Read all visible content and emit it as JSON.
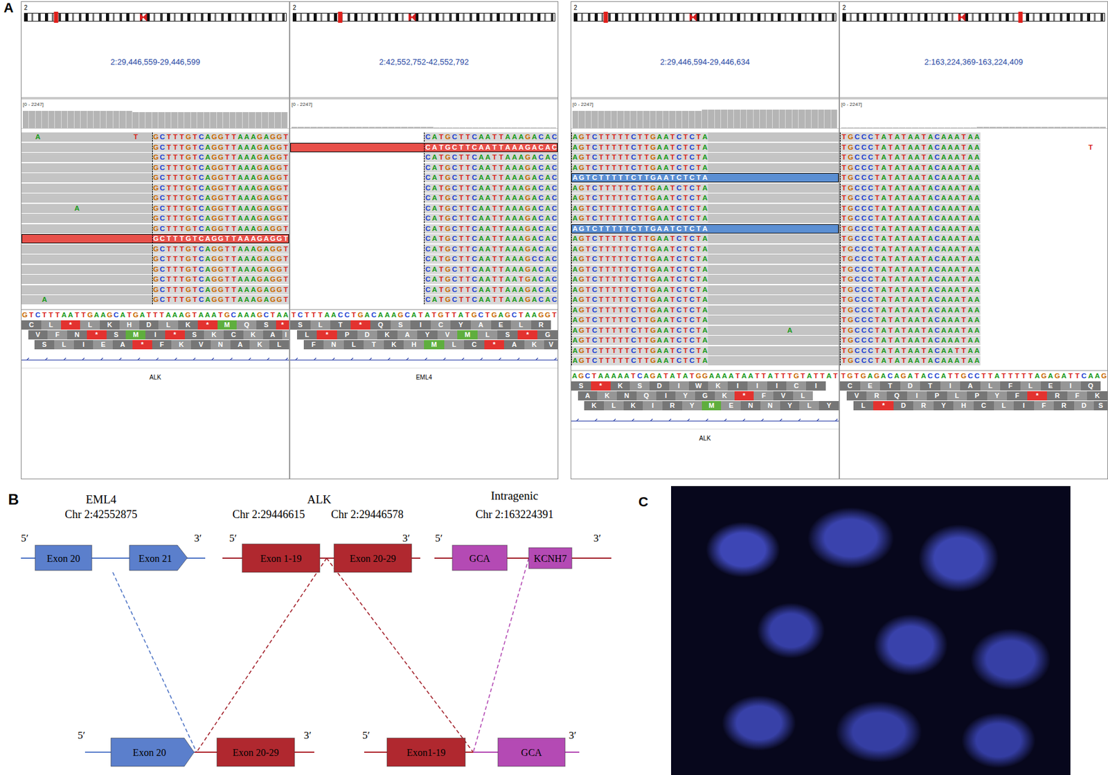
{
  "panel_a": {
    "label": "A",
    "groups": [
      {
        "panels": [
          {
            "chrom": "2",
            "locus": "2:29,446,559-29,446,599",
            "marker": 0.12,
            "range": "[0 - 2247]",
            "coverage": [
              0.86,
              0.86,
              0.86,
              0.86,
              0.86,
              0.86,
              0.86,
              0.86,
              0.86,
              0.86,
              0.86,
              0.86,
              0.86,
              0.86,
              0.86,
              0.86,
              0.86,
              0.78,
              0.78,
              0.78,
              0.78,
              0.78,
              0.78,
              0.78,
              0.78,
              0.78,
              0.78,
              0.78,
              0.78,
              0.78,
              0.78,
              0.78,
              0.78,
              0.78,
              0.78,
              0.78,
              0.78,
              0.78,
              0.78,
              0.78,
              0.78
            ],
            "aligned": [
              0,
              19
            ],
            "clip_start": 20,
            "highlight_color": "#e8504a",
            "reads": [
              {
                "bases": "GCTTTGTCAGGTTAAAGAGGT",
                "highlight": false,
                "snps": [
                  {
                    "col": 2,
                    "base": "A"
                  },
                  {
                    "col": 17,
                    "base": "T"
                  }
                ]
              },
              {
                "bases": "GCTTTGTCAGGTTAAAGAGGT",
                "highlight": false
              },
              {
                "bases": "GCTTTGTCAGGTTAAAGAGGT",
                "highlight": false
              },
              {
                "bases": "GCTTTGTCAGGTTAAAGAGGT",
                "highlight": false
              },
              {
                "bases": "GCTTTGTCAGGTTAAAGAGGT",
                "highlight": false
              },
              {
                "bases": "GCTTTGTCAGGTTAAAGAGGT",
                "highlight": false
              },
              {
                "bases": "GCTTTGTCAGGTTAAAGAGGT",
                "highlight": false
              },
              {
                "bases": "GCTTTGTCAGGTTAAAGAGGT",
                "highlight": false,
                "snps": [
                  {
                    "col": 8,
                    "base": "A"
                  }
                ]
              },
              {
                "bases": "GCTTTGTCAGGTTAAAGAGGT",
                "highlight": false
              },
              {
                "bases": "GCTTTGTCAGGTTAAAGAGGT",
                "highlight": false
              },
              {
                "bases": "GCTTTGTCAGGTTAAAGAGGT",
                "highlight": true
              },
              {
                "bases": "GCTTTGTCAGGTTAAAGAGGT",
                "highlight": false
              },
              {
                "bases": "GCTTTGTCAGGTTAAAGAGGT",
                "highlight": false
              },
              {
                "bases": "GCTTTGTCAGGTTAAAGAGGT",
                "highlight": false
              },
              {
                "bases": "GCTTTGTCAGGTTAAAGAGGT",
                "highlight": false
              },
              {
                "bases": "GCTTTGTCAGGTTAAAGAGGT",
                "highlight": false
              },
              {
                "bases": "GCTTTGTCAGGTTAAAGAGGT",
                "highlight": false,
                "snps": [
                  {
                    "col": 3,
                    "base": "A"
                  }
                ]
              }
            ],
            "reference": "GTCTTTAATTGAAGCATGATTTAAAGTAAATGCAAAGCTAA",
            "frames": [
              "CL*LKHDLK*MQS*",
              "VFN*SMI*SKCKAI",
              "SLIEA*FKVNAKL"
            ],
            "gene": "ALK"
          },
          {
            "chrom": "2",
            "locus": "2:42,552,752-42,552,792",
            "marker": 0.18,
            "range": "[0 - 2247]",
            "coverage": [
              0.05,
              0.05,
              0.05,
              0.05,
              0.05,
              0.05,
              0.05,
              0.05,
              0.05,
              0.05,
              0.05,
              0.05,
              0.05,
              0.05,
              0.05,
              0.05,
              0.05,
              0.05,
              0.05,
              0.05,
              0.05,
              0.05,
              0.03,
              0.03,
              0.03,
              0.03,
              0.03,
              0.03,
              0.03,
              0.03,
              0.03,
              0.03,
              0.03,
              0.03,
              0.03,
              0.03,
              0.03,
              0.03,
              0.03,
              0.03,
              0.03
            ],
            "clip_start": 20,
            "highlight_color": "#e8504a",
            "reads": [
              {
                "bases": "CATGCTTCAATTAAAGACAC",
                "highlight": false
              },
              {
                "bases": "CATGCTTCAATTAAAGACAC",
                "highlight": true
              },
              {
                "bases": "CATGCTTCAATTAAAGACAC",
                "highlight": false
              },
              {
                "bases": "CATGCTTCAATTAAAGACAC",
                "highlight": false
              },
              {
                "bases": "CATGCTTCAATTAAAGACAC",
                "highlight": false
              },
              {
                "bases": "CATGCTTCAATTAAAGACAC",
                "highlight": false
              },
              {
                "bases": "CATGCTTCAATTAAAGACAC",
                "highlight": false
              },
              {
                "bases": "CATGCTTCAATTAAAGACAC",
                "highlight": false
              },
              {
                "bases": "CATGCTTCAATTAAAGACAC",
                "highlight": false
              },
              {
                "bases": "CATGCTTCAATTAAAGACAC",
                "highlight": false
              },
              {
                "bases": "CATGCTTCAATTAAAGACAC",
                "highlight": false
              },
              {
                "bases": "CATGCTTCAATTAAAGACAC",
                "highlight": false
              },
              {
                "bases": "CATGCTTCAATTAAAGCCAC",
                "highlight": false
              },
              {
                "bases": "CATGCTTCAATTAAAGACAC",
                "highlight": false
              },
              {
                "bases": "CATGCTTCAATTAATGACAC",
                "highlight": false
              },
              {
                "bases": "CATGCTTCAATTAAAGACAC",
                "highlight": false
              },
              {
                "bases": "CATGCTTCAATTAAAGACAC",
                "highlight": false
              }
            ],
            "reference": "TCTTTAACCTGACAAAGCATATGTTATGCTGAGCTAAGGT",
            "frames": [
              "SLT*QSICYAELR",
              "L*PDKAYVMLS*G",
              "FNLTKHMLC*AKV"
            ],
            "gene": "EML4"
          }
        ]
      },
      {
        "panels": [
          {
            "chrom": "2",
            "locus": "2:29,446,594-29,446,634",
            "marker": 0.12,
            "range": "[0 - 2247]",
            "coverage": [
              0.84,
              0.84,
              0.84,
              0.84,
              0.84,
              0.84,
              0.84,
              0.84,
              0.84,
              0.84,
              0.84,
              0.84,
              0.84,
              0.84,
              0.84,
              0.84,
              0.84,
              0.84,
              0.84,
              0.84,
              0.9,
              0.9,
              0.9,
              0.9,
              0.9,
              0.9,
              0.9,
              0.9,
              0.9,
              0.9,
              0.9,
              0.9,
              0.9,
              0.9,
              0.9,
              0.9,
              0.9,
              0.9,
              0.9,
              0.9,
              0.9
            ],
            "aligned": [
              21,
              40
            ],
            "clip_start": 0,
            "highlight_color": "#5b8fd3",
            "reads": [
              {
                "bases": "AGTCTTTTTCTTGAATCTCTA",
                "highlight": false
              },
              {
                "bases": "AGTCTTTTTCTTGAATCTCTA",
                "highlight": false
              },
              {
                "bases": "AGTCTTTTTCTTGAATCTCTA",
                "highlight": false
              },
              {
                "bases": "AGTCTTTTTCTTGAATCTCTA",
                "highlight": false
              },
              {
                "bases": "AGTCTTTTTCTTGAATCTCTA",
                "highlight": true
              },
              {
                "bases": "AGTCTTTTTCTTGAATCTCTA",
                "highlight": false
              },
              {
                "bases": "AGTCTTTTTCTTGAATCTCTA",
                "highlight": false
              },
              {
                "bases": "AGTCTTTTTCTTGAATCTCTA",
                "highlight": false
              },
              {
                "bases": "AGTCTTTTTCTTGAATCTCTA",
                "highlight": false
              },
              {
                "bases": "AGTCTTTTTCTTGAATCTCTA",
                "highlight": true
              },
              {
                "bases": "AGTCTTTTTCTTGAATCTCTA",
                "highlight": false
              },
              {
                "bases": "AGTCTTTTTCTTGAATCTCTA",
                "highlight": false
              },
              {
                "bases": "AGTCTTTTTCTTGAATCTCTA",
                "highlight": false
              },
              {
                "bases": "AGTCTTTTTCTTGAATCTCTA",
                "highlight": false
              },
              {
                "bases": "AGTCTTTTTCTTGAATCTCTA",
                "highlight": false
              },
              {
                "bases": "AGTCTTTTTCTTGAATCTCTA",
                "highlight": false
              },
              {
                "bases": "AGTCTTTTTCTTGAATCTCTA",
                "highlight": false
              },
              {
                "bases": "AGTCTTTTTCTTGAATCTCTA",
                "highlight": false
              },
              {
                "bases": "AGTCTTTTTCTTGAATCTCTA",
                "highlight": false
              },
              {
                "bases": "AGTCTTTTTCTTGAATCTCTA",
                "highlight": false,
                "snps": [
                  {
                    "col": 33,
                    "base": "A"
                  }
                ]
              },
              {
                "bases": "AGTCTTTTTCTTGAATCTCTA",
                "highlight": false
              },
              {
                "bases": "AGTCTTTTTCTTGAATCTCTA",
                "highlight": false
              },
              {
                "bases": "AGTCTTTTTCTTGAATCTCTA",
                "highlight": false
              }
            ],
            "reference": "AGCTAAAAATCAGATATATGGAAAATAATTATTTGTATTAT",
            "frames": [
              "S*KSDIWKIIICI",
              "AKNQIYGK*FVL",
              "KLKIRYMENNYLY"
            ],
            "gene": "ALK"
          },
          {
            "chrom": "2",
            "locus": "2:163,224,369-163,224,409",
            "marker": 0.68,
            "range": "[0 - 2247]",
            "coverage": [
              0.03,
              0.03,
              0.03,
              0.03,
              0.03,
              0.03,
              0.03,
              0.03,
              0.03,
              0.03,
              0.03,
              0.03,
              0.03,
              0.03,
              0.03,
              0.03,
              0.03,
              0.03,
              0.03,
              0.03,
              0.03,
              0.06,
              0.06,
              0.06,
              0.06,
              0.06,
              0.06,
              0.06,
              0.06,
              0.06,
              0.06,
              0.06,
              0.06,
              0.06,
              0.06,
              0.06,
              0.06,
              0.06,
              0.06,
              0.06,
              0.06
            ],
            "clip_start": 0,
            "reads": [
              {
                "bases": "TGCCCTATATAATACAAATAA",
                "highlight": false
              },
              {
                "bases": "TGCCCTATATAATACAAATAA",
                "highlight": false,
                "snps": [
                  {
                    "col": 37,
                    "base": "T"
                  }
                ]
              },
              {
                "bases": "TGCCCTATATAATACAAATAA",
                "highlight": false
              },
              {
                "bases": "TGCCCTATATAATACAAATAA",
                "highlight": false
              },
              {
                "bases": "TGCCCTATATAATACAAATAA",
                "highlight": false
              },
              {
                "bases": "TGCCCTATATAATACAAATAA",
                "highlight": false
              },
              {
                "bases": "TGCCCTATATAATACAAATAA",
                "highlight": false
              },
              {
                "bases": "TGCCCTATATAATACAAATAA",
                "highlight": false
              },
              {
                "bases": "TGCCCTATATAATACAAATAA",
                "highlight": false
              },
              {
                "bases": "TGCCCTATATAATACAAATAA",
                "highlight": false
              },
              {
                "bases": "TGCCCTATATAATACAAATAA",
                "highlight": false
              },
              {
                "bases": "TGCCCTATATAATACAAATAA",
                "highlight": false
              },
              {
                "bases": "TGCCCTATATAATACAAATAA",
                "highlight": false
              },
              {
                "bases": "TGCCCTATATAATACAAATAA",
                "highlight": false
              },
              {
                "bases": "TGCCCTATATAATACAAATAA",
                "highlight": false
              },
              {
                "bases": "TGCCCTATATAATACAAATAA",
                "highlight": false
              },
              {
                "bases": "TGCCCTATATAATACAAATAA",
                "highlight": false
              },
              {
                "bases": "TGCCCTATATAATACAAATAA",
                "highlight": false
              },
              {
                "bases": "TGCCCTATATAATACAAATAA",
                "highlight": false
              },
              {
                "bases": "TGCCCTATATAATACAAATAA",
                "highlight": false
              },
              {
                "bases": "TGCCCTATATAATACAAATAA",
                "highlight": false
              },
              {
                "bases": "TGCCCTATATAATACAATTAA",
                "highlight": false
              },
              {
                "bases": "TGCCCTATATAATACAAATAA",
                "highlight": false
              }
            ],
            "reference": "TGTGAGACAGATACCATTGCCTTATTTTTAGAGATTCAAG",
            "frames": [
              "CETDTIALFLEIQ",
              "VRQIPLPYF*RFK",
              "L*DRYHCLIFRDS"
            ]
          }
        ]
      }
    ]
  },
  "panel_b": {
    "label": "B",
    "genes": [
      {
        "title": "EML4",
        "coords": [
          "Chr 2:42552875"
        ],
        "ends": [
          "5′",
          "3′"
        ],
        "line_color": "#4f75c6",
        "exons": [
          {
            "label": "Exon 20",
            "color": "#5b7fcc",
            "kind": "box"
          },
          {
            "label": "Exon 21",
            "color": "#5b7fcc",
            "kind": "arrow"
          }
        ]
      },
      {
        "title": "ALK",
        "coords": [
          "Chr 2:29446615",
          "Chr 2:29446578"
        ],
        "ends": [
          "5′",
          "3′"
        ],
        "line_color": "#a3212b",
        "exons": [
          {
            "label": "Exon 1-19",
            "color": "#b0282f",
            "kind": "box"
          },
          {
            "label": "Exon 20-29",
            "color": "#b0282f",
            "kind": "box"
          }
        ]
      },
      {
        "title": "Intragenic",
        "coords": [
          "Chr 2:163224391"
        ],
        "ends": [
          "5′",
          "3′"
        ],
        "line_color": "#a3212b",
        "exons": [
          {
            "label": "GCA",
            "color": "#b44ab4",
            "kind": "box"
          },
          {
            "label": "KCNH7",
            "color": "#b44ab4",
            "kind": "box"
          }
        ]
      }
    ],
    "fusions": [
      {
        "ends": [
          "5′",
          "3′"
        ],
        "exons": [
          {
            "label": "Exon 20",
            "color": "#5b7fcc",
            "kind": "arrow"
          },
          {
            "label": "Exon 20-29",
            "color": "#b0282f",
            "kind": "box"
          }
        ]
      },
      {
        "ends": [
          "5′",
          "3′"
        ],
        "exons": [
          {
            "label": "Exon1-19",
            "color": "#b0282f",
            "kind": "box"
          },
          {
            "label": "GCA",
            "color": "#b44ab4",
            "kind": "box"
          }
        ]
      }
    ],
    "links": [
      {
        "color": "#4f75c6"
      },
      {
        "color": "#a3212b"
      },
      {
        "color": "#a3212b"
      },
      {
        "color": "#b44ab4"
      }
    ]
  },
  "panel_c": {
    "label": "C"
  }
}
